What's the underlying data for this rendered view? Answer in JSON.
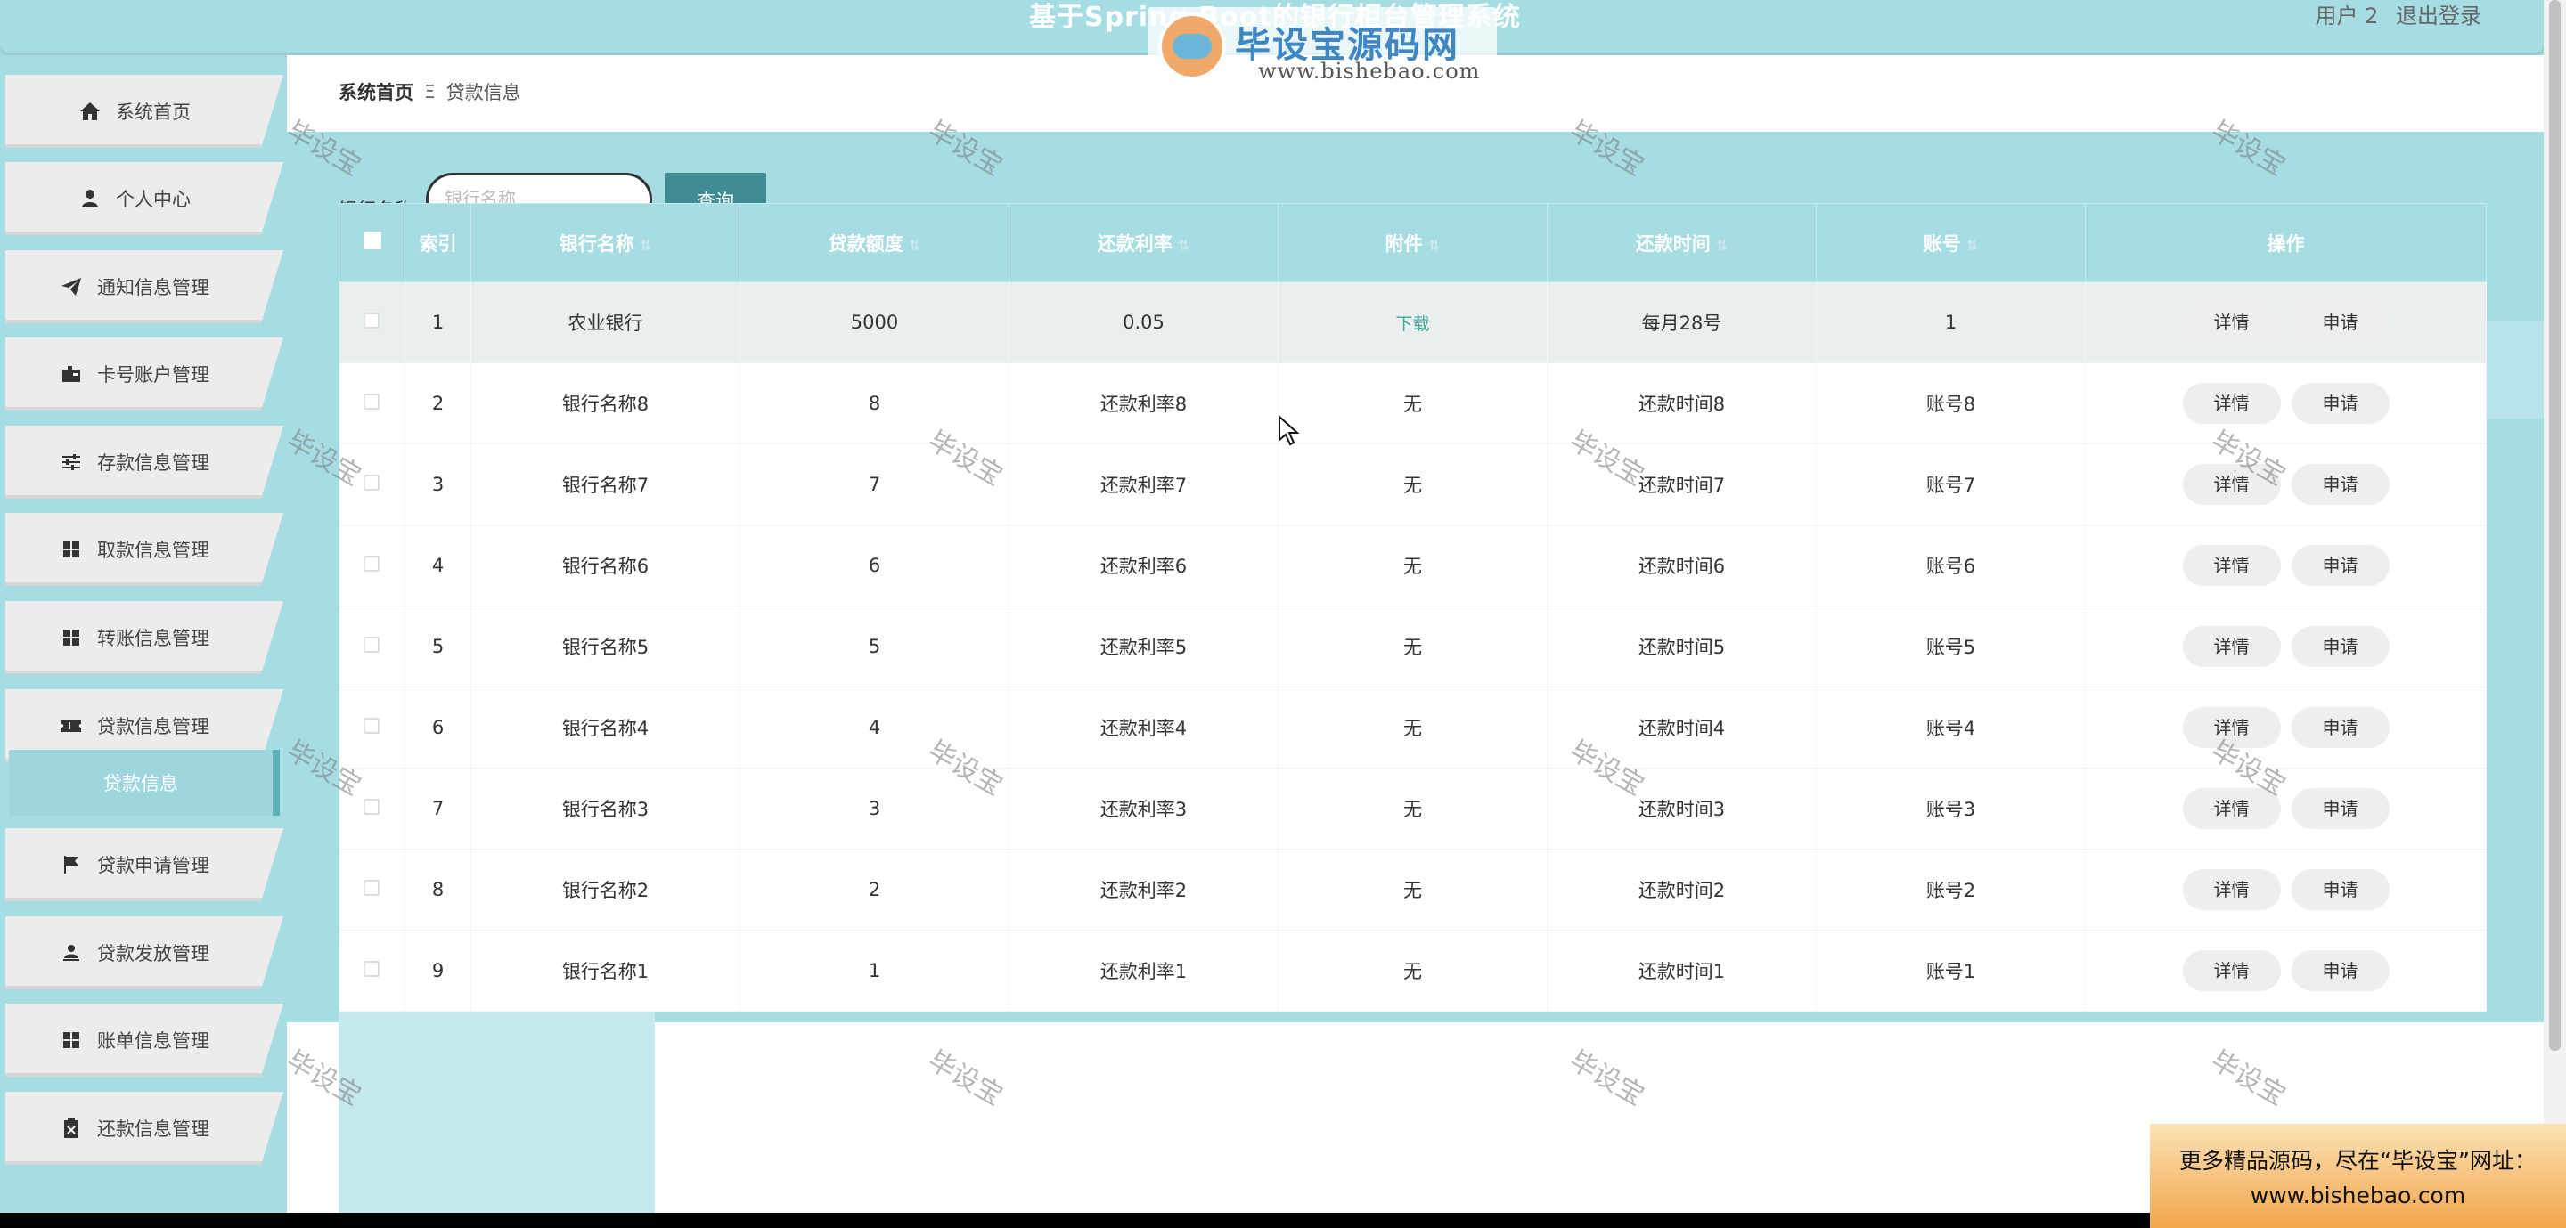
{
  "header": {
    "title": "基于Spring Boot的银行柜台管理系统",
    "user_label": "用户 2",
    "logout_label": "退出登录"
  },
  "logo": {
    "badge": "毕设宝",
    "name": "毕设宝源码网",
    "url": "www.bishebao.com"
  },
  "sidebar": {
    "items": [
      {
        "label": "系统首页",
        "icon": "home-icon"
      },
      {
        "label": "个人中心",
        "icon": "user-icon"
      },
      {
        "label": "通知信息管理",
        "icon": "paper-plane-icon"
      },
      {
        "label": "卡号账户管理",
        "icon": "card-icon"
      },
      {
        "label": "存款信息管理",
        "icon": "sliders-icon"
      },
      {
        "label": "取款信息管理",
        "icon": "grid-icon"
      },
      {
        "label": "转账信息管理",
        "icon": "grid-icon"
      },
      {
        "label": "贷款信息管理",
        "icon": "ticket-icon"
      },
      {
        "label": "贷款申请管理",
        "icon": "flag-icon"
      },
      {
        "label": "贷款发放管理",
        "icon": "user-upload-icon"
      },
      {
        "label": "账单信息管理",
        "icon": "grid-icon"
      },
      {
        "label": "还款信息管理",
        "icon": "clipboard-x-icon"
      }
    ],
    "active_sub": "贷款信息"
  },
  "breadcrumb": {
    "home": "系统首页",
    "separator": "Ξ",
    "current": "贷款信息"
  },
  "search": {
    "label": "银行名称",
    "placeholder": "银行名称",
    "button": "查询"
  },
  "table": {
    "headers": [
      "索引",
      "银行名称",
      "贷款额度",
      "还款利率",
      "附件",
      "还款时间",
      "账号",
      "操作"
    ],
    "rows": [
      {
        "index": "1",
        "bank": "农业银行",
        "amount": "5000",
        "rate": "0.05",
        "attachment": "下载",
        "time": "每月28号",
        "account": "1"
      },
      {
        "index": "2",
        "bank": "银行名称8",
        "amount": "8",
        "rate": "还款利率8",
        "attachment": "无",
        "time": "还款时间8",
        "account": "账号8"
      },
      {
        "index": "3",
        "bank": "银行名称7",
        "amount": "7",
        "rate": "还款利率7",
        "attachment": "无",
        "time": "还款时间7",
        "account": "账号7"
      },
      {
        "index": "4",
        "bank": "银行名称6",
        "amount": "6",
        "rate": "还款利率6",
        "attachment": "无",
        "time": "还款时间6",
        "account": "账号6"
      },
      {
        "index": "5",
        "bank": "银行名称5",
        "amount": "5",
        "rate": "还款利率5",
        "attachment": "无",
        "time": "还款时间5",
        "account": "账号5"
      },
      {
        "index": "6",
        "bank": "银行名称4",
        "amount": "4",
        "rate": "还款利率4",
        "attachment": "无",
        "time": "还款时间4",
        "account": "账号4"
      },
      {
        "index": "7",
        "bank": "银行名称3",
        "amount": "3",
        "rate": "还款利率3",
        "attachment": "无",
        "time": "还款时间3",
        "account": "账号3"
      },
      {
        "index": "8",
        "bank": "银行名称2",
        "amount": "2",
        "rate": "还款利率2",
        "attachment": "无",
        "time": "还款时间2",
        "account": "账号2"
      },
      {
        "index": "9",
        "bank": "银行名称1",
        "amount": "1",
        "rate": "还款利率1",
        "attachment": "无",
        "time": "还款时间1",
        "account": "账号1"
      }
    ],
    "detail_label": "详情",
    "apply_label": "申请"
  },
  "watermark": "毕设宝",
  "ad": {
    "line1": "更多精品源码，尽在“毕设宝”网址：",
    "line2": "www.bishebao.com"
  }
}
